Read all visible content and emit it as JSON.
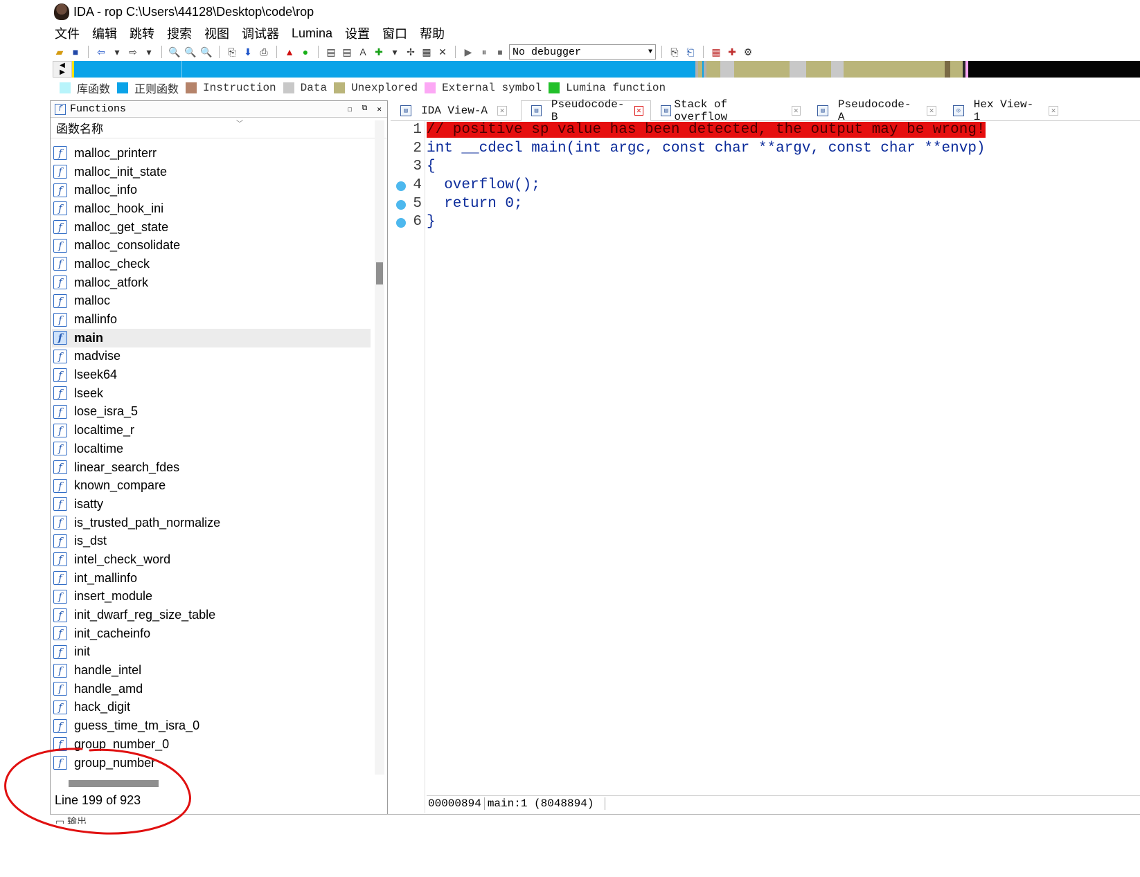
{
  "title": "IDA - rop C:\\Users\\44128\\Desktop\\code\\rop",
  "menu": [
    "文件",
    "编辑",
    "跳转",
    "搜索",
    "视图",
    "调试器",
    "Lumina",
    "设置",
    "窗口",
    "帮助"
  ],
  "toolbar": {
    "debugger_select": "No debugger",
    "icons": [
      "open-icon",
      "save-icon",
      "back-icon",
      "back-dropdown-icon",
      "forward-icon",
      "forward-dropdown-icon",
      "search-text-icon",
      "search-binary-icon",
      "search-immediate-icon",
      "search-next-icon",
      "down-arrow-icon",
      "code-icon",
      "graph-icon",
      "run-green-icon",
      "add-struct-icon",
      "add-enum-icon",
      "add-string-icon",
      "add-code-icon",
      "add-func-icon",
      "add-xref-icon",
      "delete-icon",
      "play-icon",
      "pause-icon",
      "stop-icon",
      "debugger-step-icon",
      "debugger-trace-icon",
      "view-1-icon",
      "view-2-icon",
      "view-3-icon"
    ]
  },
  "legend": [
    {
      "label": "库函数",
      "color": "#b8f4fb"
    },
    {
      "label": "正则函数",
      "color": "#0aa3e8"
    },
    {
      "label": "Instruction",
      "color": "#b5836a"
    },
    {
      "label": "Data",
      "color": "#c8c8c8"
    },
    {
      "label": "Unexplored",
      "color": "#bab57a"
    },
    {
      "label": "External symbol",
      "color": "#fca8f5"
    },
    {
      "label": "Lumina function",
      "color": "#22c02a"
    }
  ],
  "functions_pane": {
    "title": "Functions",
    "column_header": "函数名称",
    "items": [
      "malloc_printerr",
      "malloc_init_state",
      "malloc_info",
      "malloc_hook_ini",
      "malloc_get_state",
      "malloc_consolidate",
      "malloc_check",
      "malloc_atfork",
      "malloc",
      "mallinfo",
      "main",
      "madvise",
      "lseek64",
      "lseek",
      "lose_isra_5",
      "localtime_r",
      "localtime",
      "linear_search_fdes",
      "known_compare",
      "isatty",
      "is_trusted_path_normalize",
      "is_dst",
      "intel_check_word",
      "int_mallinfo",
      "insert_module",
      "init_dwarf_reg_size_table",
      "init_cacheinfo",
      "init",
      "handle_intel",
      "handle_amd",
      "hack_digit",
      "guess_time_tm_isra_0",
      "group_number_0",
      "group_number"
    ],
    "selected": "main",
    "status": "Line 199 of 923"
  },
  "output_tab_label": "输出",
  "tabs": [
    {
      "label": "IDA View-A",
      "icon": "ida-view-icon",
      "active": false
    },
    {
      "label": "Pseudocode-B",
      "icon": "pseudocode-icon",
      "active": true
    },
    {
      "label": "Stack of overflow",
      "icon": "stack-icon",
      "active": false
    },
    {
      "label": "Pseudocode-A",
      "icon": "pseudocode-icon",
      "active": false
    },
    {
      "label": "Hex View-1",
      "icon": "hex-view-icon",
      "active": false
    }
  ],
  "code": {
    "lines": [
      {
        "num": "1",
        "text": "// positive sp value has been detected, the output may be wrong!",
        "warning": true,
        "breakpoint": false
      },
      {
        "num": "2",
        "text": "int __cdecl main(int argc, const char **argv, const char **envp)",
        "warning": false,
        "breakpoint": false
      },
      {
        "num": "3",
        "text": "{",
        "warning": false,
        "breakpoint": false
      },
      {
        "num": "4",
        "text": "  overflow();",
        "warning": false,
        "breakpoint": true
      },
      {
        "num": "5",
        "text": "  return 0;",
        "warning": false,
        "breakpoint": true
      },
      {
        "num": "6",
        "text": "}",
        "warning": false,
        "breakpoint": true
      }
    ],
    "status_address": "00000894",
    "status_location": "main:1  (8048894)"
  },
  "colors": {
    "warning_bg": "#e60f0f",
    "code_text": "#0a2a9a",
    "nav_strip_base": "#0aa3e8",
    "annotation": "#e01010"
  }
}
